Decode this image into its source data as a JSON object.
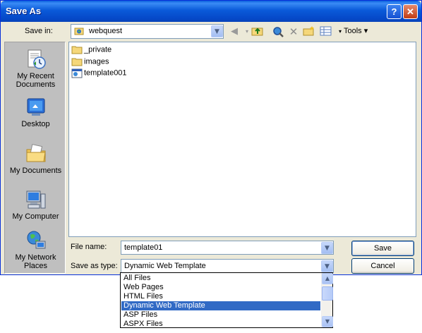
{
  "window": {
    "title": "Save As",
    "help_label": "?",
    "close_label": "✕"
  },
  "toolbar": {
    "save_in_label": "Save in:",
    "location": "webquest",
    "tools_label": "Tools"
  },
  "places": [
    {
      "label": "My Recent Documents",
      "icon": "recent-documents-icon"
    },
    {
      "label": "Desktop",
      "icon": "desktop-icon"
    },
    {
      "label": "My Documents",
      "icon": "my-documents-icon"
    },
    {
      "label": "My Computer",
      "icon": "my-computer-icon"
    },
    {
      "label": "My Network Places",
      "icon": "network-places-icon"
    }
  ],
  "files": [
    {
      "name": "_private",
      "type": "folder"
    },
    {
      "name": "images",
      "type": "folder"
    },
    {
      "name": "template001",
      "type": "web-template"
    }
  ],
  "form": {
    "file_name_label": "File name:",
    "file_name_value": "template01",
    "save_as_type_label": "Save as type:",
    "save_as_type_value": "Dynamic Web Template",
    "save_label": "Save",
    "cancel_label": "Cancel"
  },
  "dropdown": {
    "options": [
      "All Files",
      "Web Pages",
      "HTML Files",
      "Dynamic Web Template",
      "ASP Files",
      "ASPX Files"
    ],
    "selected": "Dynamic Web Template"
  },
  "colors": {
    "titlebar": "#0a5ad9",
    "selection": "#316ac5",
    "dialog_bg": "#ece9d8"
  }
}
